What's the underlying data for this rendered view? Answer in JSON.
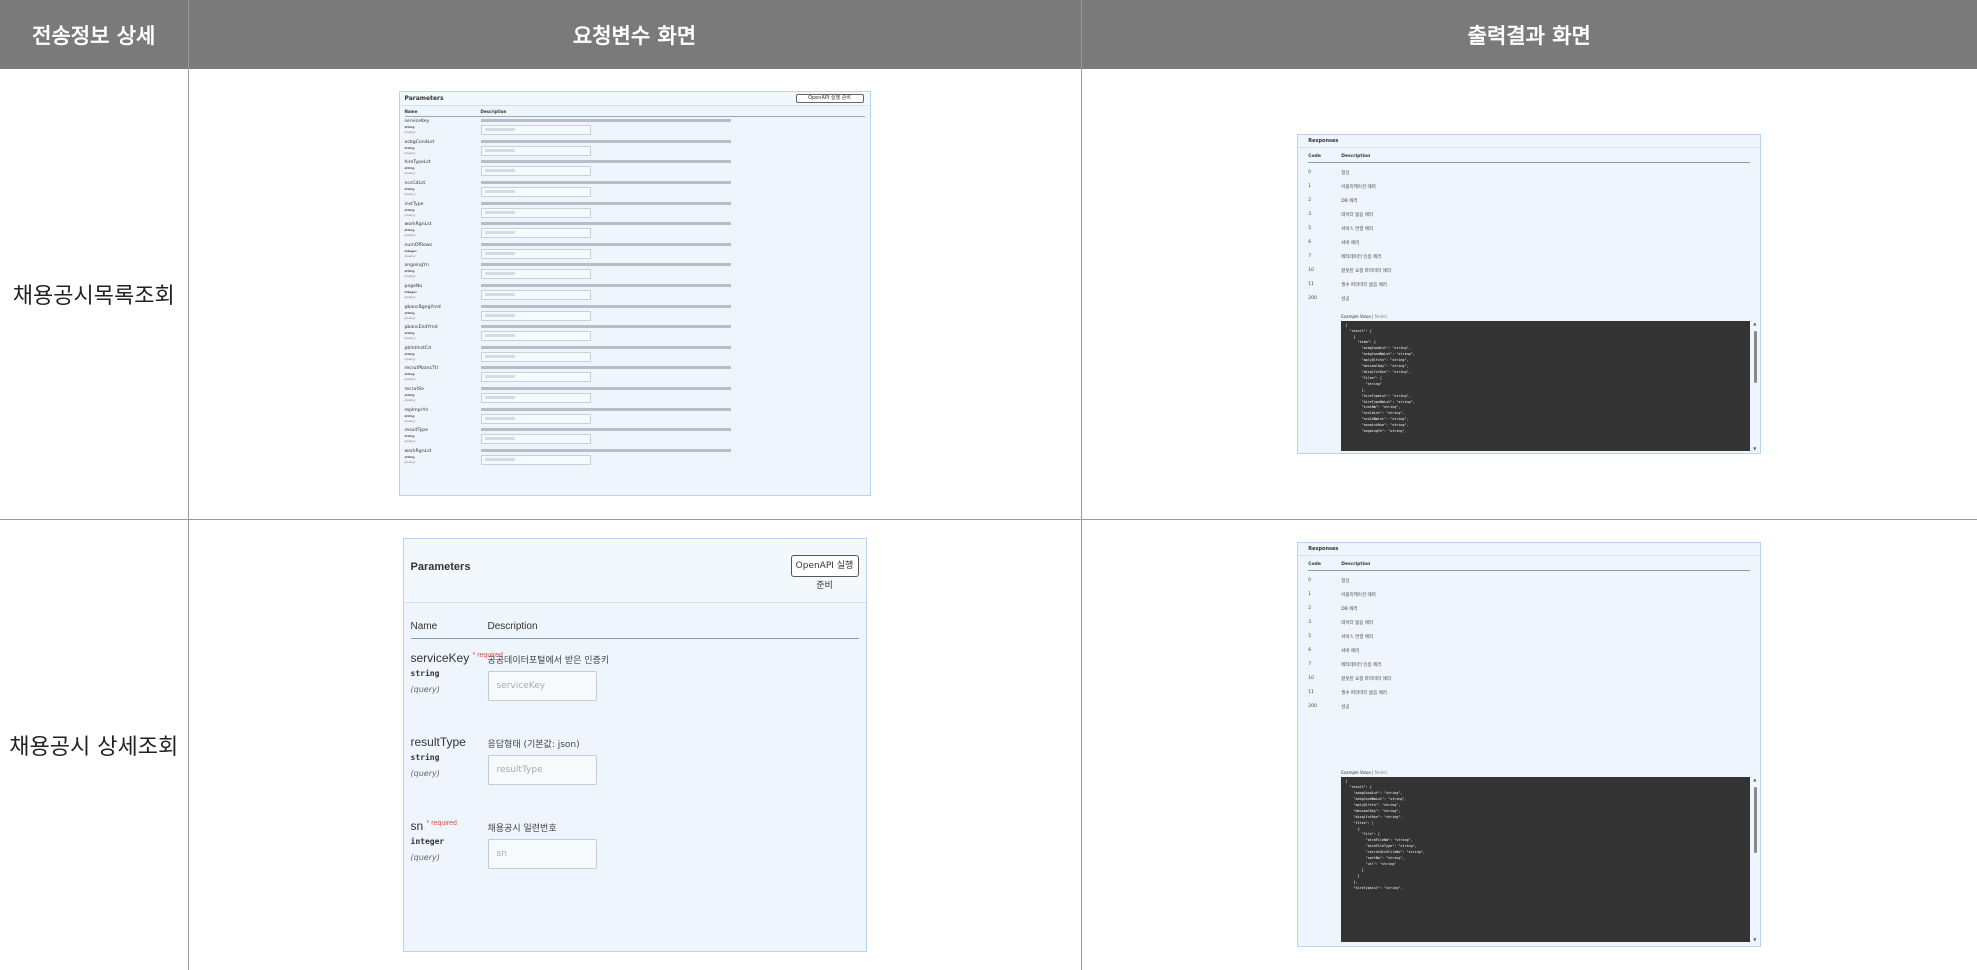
{
  "headers": [
    "전송정보 상세",
    "요청변수 화면",
    "출력결과 화면"
  ],
  "rows": [
    {
      "label": "채용공시목록조회",
      "params": {
        "title": "Parameters",
        "button": "OpenAPI 실행 준비",
        "col_name": "Name",
        "col_desc": "Description",
        "items": [
          {
            "name": "serviceKey",
            "type": "string",
            "in": "(query)"
          },
          {
            "name": "acbgCondLst",
            "type": "string",
            "in": "(query)"
          },
          {
            "name": "hireTypeLst",
            "type": "string",
            "in": "(query)"
          },
          {
            "name": "ncsCdLst",
            "type": "string",
            "in": "(query)"
          },
          {
            "name": "instType",
            "type": "string",
            "in": "(query)"
          },
          {
            "name": "workRgnLst",
            "type": "string",
            "in": "(query)"
          },
          {
            "name": "numOfRows",
            "type": "integer",
            "in": "(query)"
          },
          {
            "name": "ongoingYn",
            "type": "string",
            "in": "(query)"
          },
          {
            "name": "pageNo",
            "type": "integer",
            "in": "(query)"
          },
          {
            "name": "pbancBgngYmd",
            "type": "string",
            "in": "(query)"
          },
          {
            "name": "pbancEndYmd",
            "type": "string",
            "in": "(query)"
          },
          {
            "name": "pblntInstCd",
            "type": "string",
            "in": "(query)"
          },
          {
            "name": "recrutPbancTtl",
            "type": "string",
            "in": "(query)"
          },
          {
            "name": "recrutSe",
            "type": "string",
            "in": "(query)"
          },
          {
            "name": "replmprYn",
            "type": "string",
            "in": "(query)"
          },
          {
            "name": "resultType",
            "type": "string",
            "in": "(query)"
          },
          {
            "name": "workRgnLst",
            "type": "string",
            "in": "(query)"
          }
        ]
      },
      "responses": {
        "title": "Responses",
        "col_code": "Code",
        "col_desc": "Description",
        "codes": [
          {
            "code": "0",
            "desc": "정상"
          },
          {
            "code": "1",
            "desc": "어플리케이션 에러"
          },
          {
            "code": "2",
            "desc": "DB 에러"
          },
          {
            "code": "3",
            "desc": "데이터 없음 에러"
          },
          {
            "code": "5",
            "desc": "서비스 연결 에러"
          },
          {
            "code": "6",
            "desc": "서버 에러"
          },
          {
            "code": "7",
            "desc": "메타데이터 인증 에러"
          },
          {
            "code": "10",
            "desc": "잘못된 요청 파라미터 에러"
          },
          {
            "code": "11",
            "desc": "필수 파라미터 없음 에러"
          },
          {
            "code": "200",
            "desc": "성공"
          }
        ],
        "example_tab": "Example Value",
        "model_tab": "Model",
        "code_lines": [
          "{",
          "  \"result\": {",
          "    {",
          "      \"item\": {",
          "        \"acbgCondLst\": \"string\",",
          "        \"acbgCondNmLst\": \"string\",",
          "        \"aplyQlfctn\": \"string\",",
          "        \"decimalDay\": \"string\",",
          "        \"disqlfctRsn\": \"string\",",
          "        \"files\": [",
          "          \"string\"",
          "        ],",
          "        \"hireTypeLst\": \"string\",",
          "        \"hireTypeNmLst\": \"string\",",
          "        \"instNm\": \"string\",",
          "        \"ncsCdLst\": \"string\",",
          "        \"ncsCdNmLst\": \"string\",",
          "        \"nonatchRsn\": \"string\",",
          "        \"ongoingYn\": \"string\","
        ]
      }
    },
    {
      "label": "채용공시 상세조회",
      "params": {
        "title": "Parameters",
        "button": "OpenAPI 실행 준비",
        "col_name": "Name",
        "col_desc": "Description",
        "items": [
          {
            "name": "serviceKey",
            "required": "* required",
            "type": "string",
            "in": "(query)",
            "desc": "공공데이터포털에서 받은 인증키",
            "placeholder": "serviceKey"
          },
          {
            "name": "resultType",
            "required": "",
            "type": "string",
            "in": "(query)",
            "desc": "응답형태 (기본값: json)",
            "placeholder": "resultType"
          },
          {
            "name": "sn",
            "required": "* required",
            "type": "integer",
            "in": "(query)",
            "desc": "채용공시 일련번호",
            "placeholder": "sn"
          }
        ]
      },
      "responses": {
        "title": "Responses",
        "col_code": "Code",
        "col_desc": "Description",
        "codes": [
          {
            "code": "0",
            "desc": "정상"
          },
          {
            "code": "1",
            "desc": "어플리케이션 에러"
          },
          {
            "code": "2",
            "desc": "DB 에러"
          },
          {
            "code": "3",
            "desc": "데이터 없음 에러"
          },
          {
            "code": "5",
            "desc": "서비스 연결 에러"
          },
          {
            "code": "6",
            "desc": "서버 에러"
          },
          {
            "code": "7",
            "desc": "메타데이터 인증 에러"
          },
          {
            "code": "10",
            "desc": "잘못된 요청 파라미터 에러"
          },
          {
            "code": "11",
            "desc": "필수 파라미터 없음 에러"
          },
          {
            "code": "200",
            "desc": "성공"
          }
        ],
        "example_tab": "Example Value",
        "model_tab": "Model",
        "code_lines": [
          "{",
          "  \"result\": {",
          "    \"acbgCondLst\": \"string\",",
          "    \"acbgCondNmLst\": \"string\",",
          "    \"aplyQlfctn\": \"string\",",
          "    \"decimalDay\": \"string\",",
          "    \"disqlfctRsn\": \"string\",",
          "    \"files\": [",
          "      {",
          "        \"file\": {",
          "          \"atchFileNm\": \"string\",",
          "          \"atchFileType\": \"string\",",
          "          \"recrutAtchFileNo\": \"string\",",
          "          \"sortNo\": \"string\",",
          "          \"url\": \"string\"",
          "        }",
          "      }",
          "    ],",
          "    \"hireTypeLst\": \"string\","
        ]
      }
    }
  ]
}
